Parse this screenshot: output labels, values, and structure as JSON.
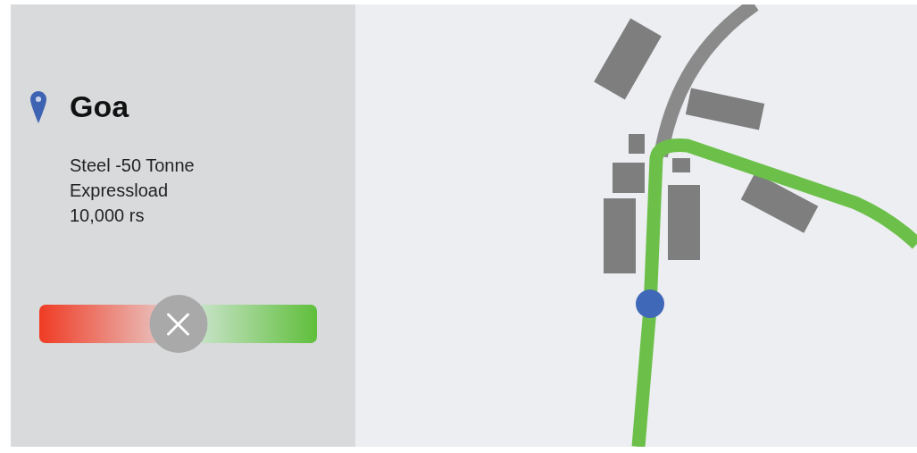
{
  "place": {
    "title": "Goa",
    "details": [
      "Steel -50 Tonne",
      "Expressload",
      "10,000 rs"
    ]
  },
  "slider": {
    "level": 0.5
  }
}
